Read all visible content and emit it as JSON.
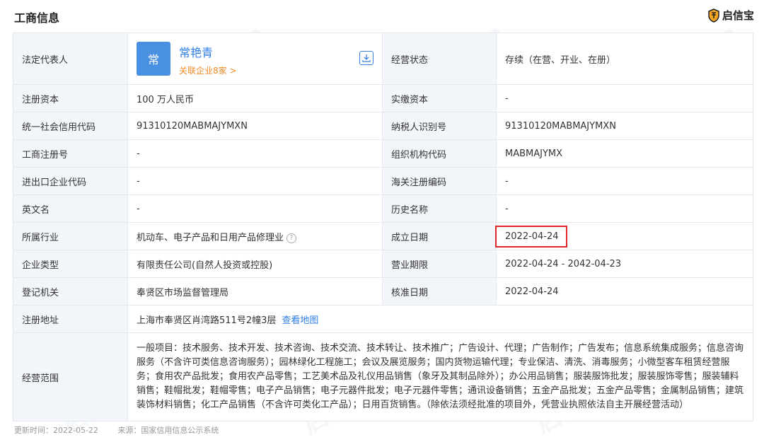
{
  "header": {
    "title": "工商信息",
    "brand": "启信宝"
  },
  "representative": {
    "label": "法定代表人",
    "avatar": "常",
    "name": "常艳青",
    "related": "关联企业8家 >",
    "status_label": "经营状态",
    "status_value": "存续（在营、开业、在册）"
  },
  "rows": [
    {
      "l1": "注册资本",
      "v1": "100 万人民币",
      "l2": "实缴资本",
      "v2": "-"
    },
    {
      "l1": "统一社会信用代码",
      "v1": "91310120MABMAJYMXN",
      "l2": "纳税人识别号",
      "v2": "91310120MABMAJYMXN"
    },
    {
      "l1": "工商注册号",
      "v1": "-",
      "l2": "组织机构代码",
      "v2": "MABMAJYMX"
    },
    {
      "l1": "进出口企业代码",
      "v1": "-",
      "l2": "海关注册编码",
      "v2": "-"
    },
    {
      "l1": "英文名",
      "v1": "-",
      "l2": "历史名称",
      "v2": "-"
    },
    {
      "l1": "所属行业",
      "v1": "机动车、电子产品和日用产品修理业",
      "l2": "成立日期",
      "v2": "2022-04-24"
    },
    {
      "l1": "企业类型",
      "v1": "有限责任公司(自然人投资或控股)",
      "l2": "营业期限",
      "v2": "2022-04-24 - 2042-04-23"
    },
    {
      "l1": "登记机关",
      "v1": "奉贤区市场监督管理局",
      "l2": "核准日期",
      "v2": "2022-04-24"
    }
  ],
  "address": {
    "label": "注册地址",
    "value": "上海市奉贤区肖湾路511号2幢3层",
    "map_link": "查看地图"
  },
  "scope": {
    "label": "经营范围",
    "value": "一般项目：技术服务、技术开发、技术咨询、技术交流、技术转让、技术推广；广告设计、代理；广告制作；广告发布；信息系统集成服务；信息咨询服务（不含许可类信息咨询服务）；园林绿化工程施工；会议及展览服务；国内货物运输代理；专业保洁、清洗、消毒服务；小微型客车租赁经营服务；食用农产品批发；食用农产品零售；工艺美术品及礼仪用品销售（象牙及其制品除外）；办公用品销售；服装服饰批发；服装服饰零售；服装辅料销售；鞋帽批发；鞋帽零售；电子产品销售；电子元器件批发；电子元器件零售；通讯设备销售；五金产品批发；五金产品零售；金属制品销售；建筑装饰材料销售；化工产品销售（不含许可类化工产品）；日用百货销售。（除依法须经批准的项目外，凭营业执照依法自主开展经营活动）"
  },
  "footer": {
    "updated": "更新时间：2022-05-22",
    "source": "来源：国家信用信息公示系统"
  },
  "watermark": {
    "cn": "启信宝",
    "en": "qixin.com"
  },
  "colors": {
    "label_bg": "#f2f5fa",
    "link": "#2f7ee6",
    "highlight": "#e0252b",
    "related": "#f08a24"
  }
}
